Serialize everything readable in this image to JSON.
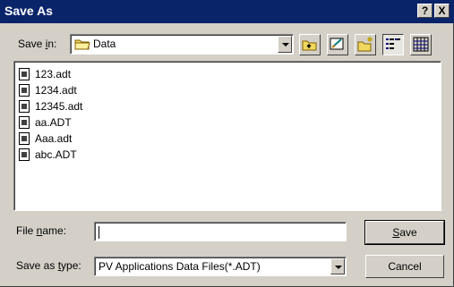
{
  "title": "Save As",
  "title_buttons": {
    "help": "?",
    "close": "X"
  },
  "save_in": {
    "label_prefix": "Save ",
    "label_key": "i",
    "label_suffix": "n:",
    "value": "Data"
  },
  "toolbar": {
    "icons": [
      "up-one-level-icon",
      "desktop-icon",
      "new-folder-icon",
      "list-view-icon",
      "details-view-icon"
    ]
  },
  "files": [
    "123.adt",
    "1234.adt",
    "12345.adt",
    "aa.ADT",
    "Aaa.adt",
    "abc.ADT"
  ],
  "file_name": {
    "label_prefix": "File ",
    "label_key": "n",
    "label_suffix": "ame:",
    "value": ""
  },
  "save_as_type": {
    "label_prefix": "Save as ",
    "label_key": "t",
    "label_suffix": "ype:",
    "value": "PV Applications Data Files(*.ADT)"
  },
  "buttons": {
    "save_key": "S",
    "save_rest": "ave",
    "cancel": "Cancel"
  },
  "colors": {
    "titlebar": "#0a246a",
    "face": "#d4d0c8"
  }
}
